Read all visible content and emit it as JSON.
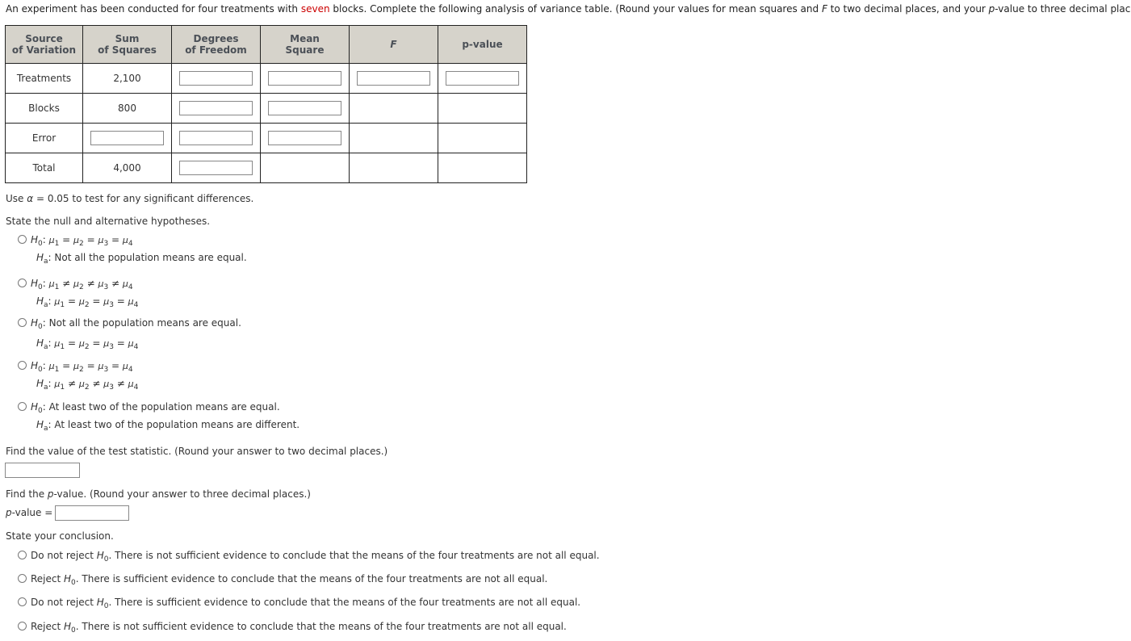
{
  "intro": {
    "part1": "An experiment has been conducted for four treatments with ",
    "highlight": "seven",
    "part2": " blocks. Complete the following analysis of variance table. (Round your values for mean squares and ",
    "f_letter": "F",
    "part3": " to two decimal places, and your ",
    "p_letter": "p",
    "part4": "-value to three decimal places.)"
  },
  "table": {
    "headers": [
      {
        "line1": "Source",
        "line2": "of Variation"
      },
      {
        "line1": "Sum",
        "line2": "of Squares"
      },
      {
        "line1": "Degrees",
        "line2": "of Freedom"
      },
      {
        "line1": "Mean",
        "line2": "Square"
      },
      {
        "line1": "F",
        "line2": ""
      },
      {
        "line1": "p-value",
        "line2": ""
      }
    ],
    "rows": [
      {
        "source": "Treatments",
        "ss": "2,100",
        "df": "",
        "ms": "",
        "f": "",
        "p": ""
      },
      {
        "source": "Blocks",
        "ss": "800",
        "df": "",
        "ms": ""
      },
      {
        "source": "Error",
        "ss": "",
        "df": "",
        "ms": ""
      },
      {
        "source": "Total",
        "ss": "4,000",
        "df": ""
      }
    ]
  },
  "alpha_text": {
    "pre": "Use ",
    "symbol": "α",
    "post": " = 0.05 to test for any significant differences."
  },
  "hypotheses_prompt": "State the null and alternative hypotheses.",
  "hypotheses_options": [
    {
      "h0": "μ1 = μ2 = μ3 = μ4",
      "ha": "Not all the population means are equal."
    },
    {
      "h0": "μ1 ≠ μ2 ≠ μ3 ≠ μ4",
      "ha": "μ1 = μ2 = μ3 = μ4"
    },
    {
      "h0": "Not all the population means are equal.",
      "ha": "μ1 = μ2 = μ3 = μ4"
    },
    {
      "h0": "μ1 = μ2 = μ3 = μ4",
      "ha": "μ1 ≠ μ2 ≠ μ3 ≠ μ4"
    },
    {
      "h0": "At least two of the population means are equal.",
      "ha": "At least two of the population means are different."
    }
  ],
  "test_stat_prompt": "Find the value of the test statistic. (Round your answer to two decimal places.)",
  "test_stat_value": "",
  "pvalue_prompt": {
    "pre": "Find the ",
    "p": "p",
    "post": "-value. (Round your answer to three decimal places.)"
  },
  "pvalue_label": {
    "p": "p",
    "post": "-value ="
  },
  "pvalue_value": "",
  "conclusion_prompt": "State your conclusion.",
  "conclusion_options": [
    {
      "pre": "Do not reject ",
      "post": ". There is not sufficient evidence to conclude that the means of the four treatments are not all equal."
    },
    {
      "pre": "Reject ",
      "post": ". There is sufficient evidence to conclude that the means of the four treatments are not all equal."
    },
    {
      "pre": "Do not reject ",
      "post": ". There is sufficient evidence to conclude that the means of the four treatments are not all equal."
    },
    {
      "pre": "Reject ",
      "post": ". There is not sufficient evidence to conclude that the means of the four treatments are not all equal."
    }
  ],
  "colors": {
    "highlight": "#cc0000",
    "header_bg": "#d6d3cb"
  }
}
